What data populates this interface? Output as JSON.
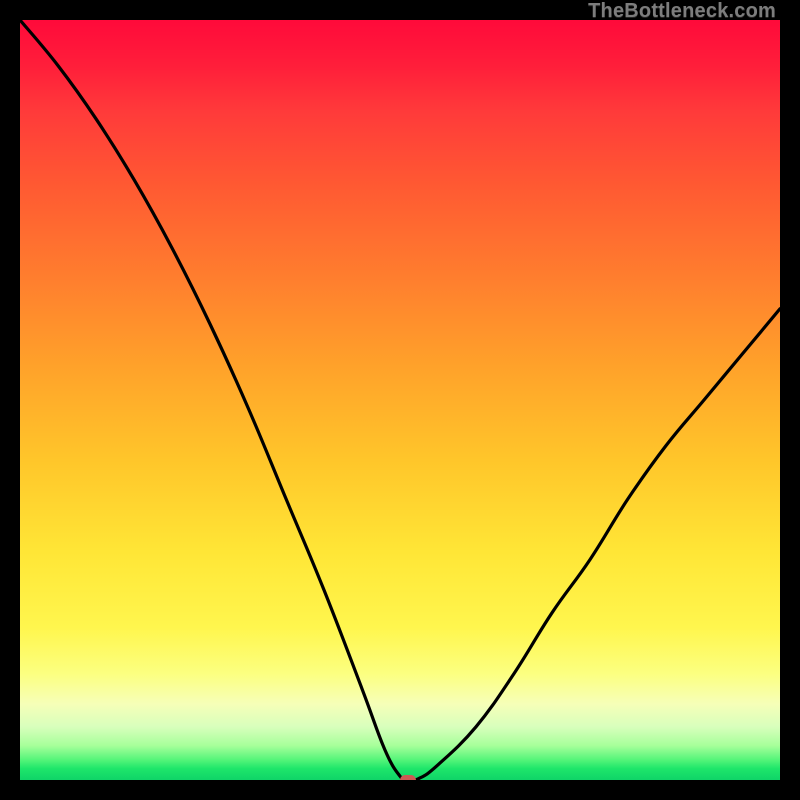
{
  "attribution": "TheBottleneck.com",
  "colors": {
    "frame": "#000000",
    "curve_stroke": "#000000",
    "marker": "#cc5a54",
    "gradient_top": "#ff0a3a",
    "gradient_mid": "#ffe636",
    "gradient_bottom": "#0fd468"
  },
  "chart_data": {
    "type": "line",
    "title": "",
    "xlabel": "",
    "ylabel": "",
    "xlim": [
      0,
      100
    ],
    "ylim": [
      0,
      100
    ],
    "grid": false,
    "legend": false,
    "note": "V-shaped bottleneck curve on a rainbow (red→green) vertical gradient; the minimum touches y≈0 near x≈51, marked by a small rounded pill. Left branch starts at top-left corner (y≈100), right branch rises to y≈62 at x=100. No numeric axis ticks are visible.",
    "series": [
      {
        "name": "bottleneck-curve",
        "x": [
          0,
          5,
          10,
          15,
          20,
          25,
          30,
          35,
          40,
          45,
          48,
          50,
          51,
          52.5,
          55,
          60,
          65,
          70,
          75,
          80,
          85,
          90,
          95,
          100
        ],
        "y": [
          100,
          94,
          87,
          79,
          70,
          60,
          49,
          37,
          25,
          12,
          4,
          0.5,
          0,
          0.2,
          2,
          7,
          14,
          22,
          29,
          37,
          44,
          50,
          56,
          62
        ]
      }
    ],
    "marker": {
      "x": 51,
      "y": 0
    }
  }
}
